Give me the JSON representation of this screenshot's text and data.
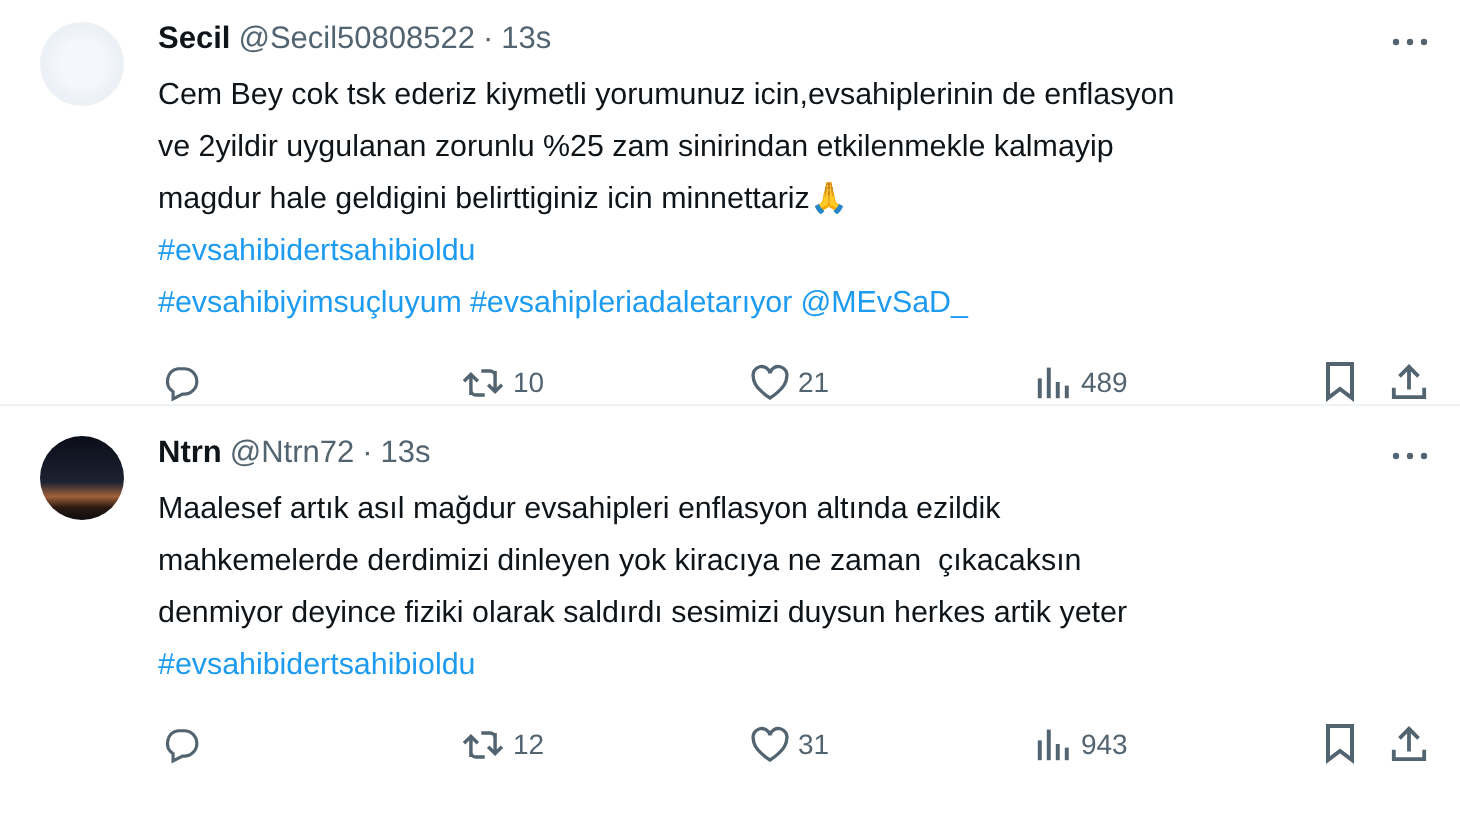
{
  "tweets": [
    {
      "name": "Secil",
      "handle": "@Secil50808522",
      "separator": "·",
      "time": "13s",
      "avatar": {
        "kind": "logo"
      },
      "paragraph": "Cem Bey cok tsk ederiz kiymetli yorumunuz icin,evsahiplerinin de enflasyon\nve 2yildir uygulanan zorunlu %25 zam sinirindan etkilenmekle kalmayip\nmagdur hale geldigini belirttiginiz icin minnettariz🙏",
      "link_lines": [
        [
          "#evsahibidertsahibioldu"
        ],
        [
          "#evsahibiyimsuçluyum",
          "#evsahipleriadaletarıyor",
          "@MEvSaD_"
        ]
      ],
      "retweets": "10",
      "likes": "21",
      "views": "489"
    },
    {
      "name": "Ntrn",
      "handle": "@Ntrn72",
      "separator": "·",
      "time": "13s",
      "avatar": {
        "kind": "photo"
      },
      "paragraph": "Maalesef artık asıl mağdur evsahipleri enflasyon altında ezildik\nmahkemelerde derdimizi dinleyen yok kiracıya ne zaman  çıkacaksın\ndenmiyor deyince fiziki olarak saldırdı sesimizi duysun herkes artik yeter",
      "link_lines": [
        [
          "#evsahibidertsahibioldu"
        ]
      ],
      "retweets": "12",
      "likes": "31",
      "views": "943"
    }
  ]
}
